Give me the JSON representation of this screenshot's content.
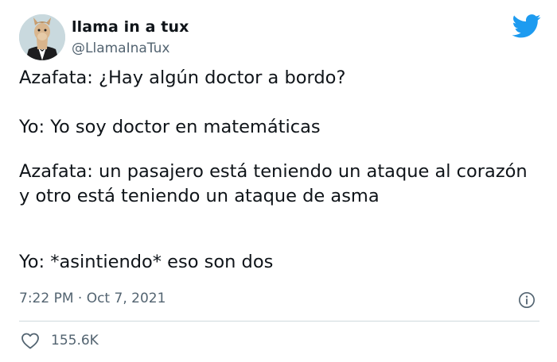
{
  "user": {
    "display_name": "llama in a tux",
    "handle": "@LlamaInaTux"
  },
  "tweet": {
    "paragraphs": [
      "Azafata: ¿Hay algún doctor a bordo?",
      "Yo: Yo soy doctor en matemáticas",
      "Azafata: un pasajero está teniendo un ataque al corazón y otro está teniendo un ataque de asma",
      "Yo: *asintiendo* eso son dos"
    ],
    "timestamp": "7:22 PM · Oct 7, 2021"
  },
  "engagement": {
    "likes": "155.6K"
  },
  "icons": {
    "brand": "twitter-bird-icon",
    "info": "info-icon",
    "like": "heart-icon"
  },
  "colors": {
    "brand": "#1d9bf0",
    "text": "#0f1419",
    "secondary": "#536471",
    "divider": "#cfd9de"
  }
}
